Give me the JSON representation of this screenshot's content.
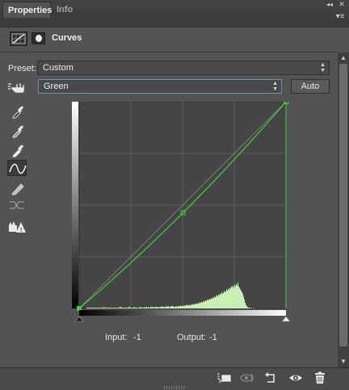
{
  "tabs": [
    {
      "label": "Properties",
      "active": true
    },
    {
      "label": "Info",
      "active": false
    }
  ],
  "header": {
    "title": "Curves",
    "icons": [
      "curves-adjustment-icon",
      "layer-mask-icon"
    ]
  },
  "preset": {
    "label": "Preset:",
    "selected": "Custom"
  },
  "channel": {
    "selected": "Green",
    "auto_label": "Auto"
  },
  "tools": [
    "on-image-adjust-icon",
    "sample-shadows-eyedropper-icon",
    "sample-midtones-eyedropper-icon",
    "sample-highlights-eyedropper-icon",
    "edit-curve-points-icon",
    "draw-curve-pencil-icon",
    "smooth-curve-icon",
    "clipping-warning-icon"
  ],
  "readout": {
    "input_label": "Input:",
    "input_value": "-1",
    "output_label": "Output:",
    "output_value": "-1"
  },
  "curve": {
    "channel_color": "#3cd23c",
    "points": [
      [
        0,
        0
      ],
      [
        128,
        118
      ],
      [
        255,
        255
      ]
    ],
    "range": [
      0,
      255
    ]
  },
  "histogram": {
    "color": "#c8f0b4",
    "levels": [
      0,
      0,
      0,
      0,
      0,
      0,
      0,
      0,
      0,
      1,
      1,
      1,
      1,
      1,
      1,
      1,
      1,
      1,
      1,
      1,
      1,
      1,
      1,
      1,
      1,
      1,
      1,
      1,
      1,
      1,
      2,
      1,
      1,
      1,
      1,
      1,
      1,
      1,
      1,
      1,
      1,
      1,
      1,
      1,
      1,
      1,
      1,
      1,
      1,
      1,
      2,
      2,
      1,
      1,
      1,
      1,
      1,
      1,
      1,
      1,
      1,
      2,
      2,
      1,
      1,
      1,
      1,
      1,
      2,
      1,
      1,
      1,
      1,
      1,
      1,
      2,
      2,
      1,
      1,
      1,
      2,
      1,
      2,
      2,
      1,
      2,
      1,
      1,
      2,
      2,
      2,
      2,
      1,
      2,
      2,
      2,
      2,
      2,
      1,
      2,
      2,
      2,
      3,
      2,
      2,
      2,
      2,
      3,
      2,
      3,
      3,
      2,
      2,
      3,
      3,
      3,
      3,
      2,
      2,
      3,
      2,
      3,
      3,
      3,
      3,
      4,
      3,
      3,
      4,
      3,
      4,
      4,
      4,
      5,
      4,
      4,
      5,
      4,
      5,
      5,
      6,
      5,
      6,
      6,
      6,
      7,
      6,
      7,
      8,
      7,
      8,
      9,
      8,
      9,
      10,
      9,
      11,
      10,
      12,
      11,
      12,
      13,
      12,
      14,
      13,
      15,
      14,
      16,
      15,
      17,
      18,
      16,
      19,
      18,
      20,
      19,
      22,
      20,
      21,
      24,
      22,
      23,
      26,
      24,
      27,
      25,
      28,
      27,
      30,
      29,
      31,
      28,
      32,
      30,
      33,
      31,
      35,
      30,
      28,
      26,
      24,
      22,
      20,
      16,
      12,
      8,
      5,
      3,
      2,
      1,
      1,
      1,
      0,
      1,
      0,
      0,
      1,
      0,
      0,
      0,
      0,
      0,
      0,
      0,
      0,
      0,
      0,
      0,
      0,
      0,
      0,
      0,
      0,
      0,
      0,
      0,
      0,
      0,
      0,
      0,
      0,
      0,
      0,
      0,
      0,
      0,
      0,
      0,
      0,
      0,
      0,
      0,
      0,
      0,
      0,
      0,
      0,
      0,
      0
    ]
  },
  "footer": {
    "icons": [
      "clip-to-layer-icon",
      "view-previous-state-icon",
      "reset-adjustments-icon",
      "toggle-visibility-icon",
      "delete-layer-icon"
    ]
  }
}
